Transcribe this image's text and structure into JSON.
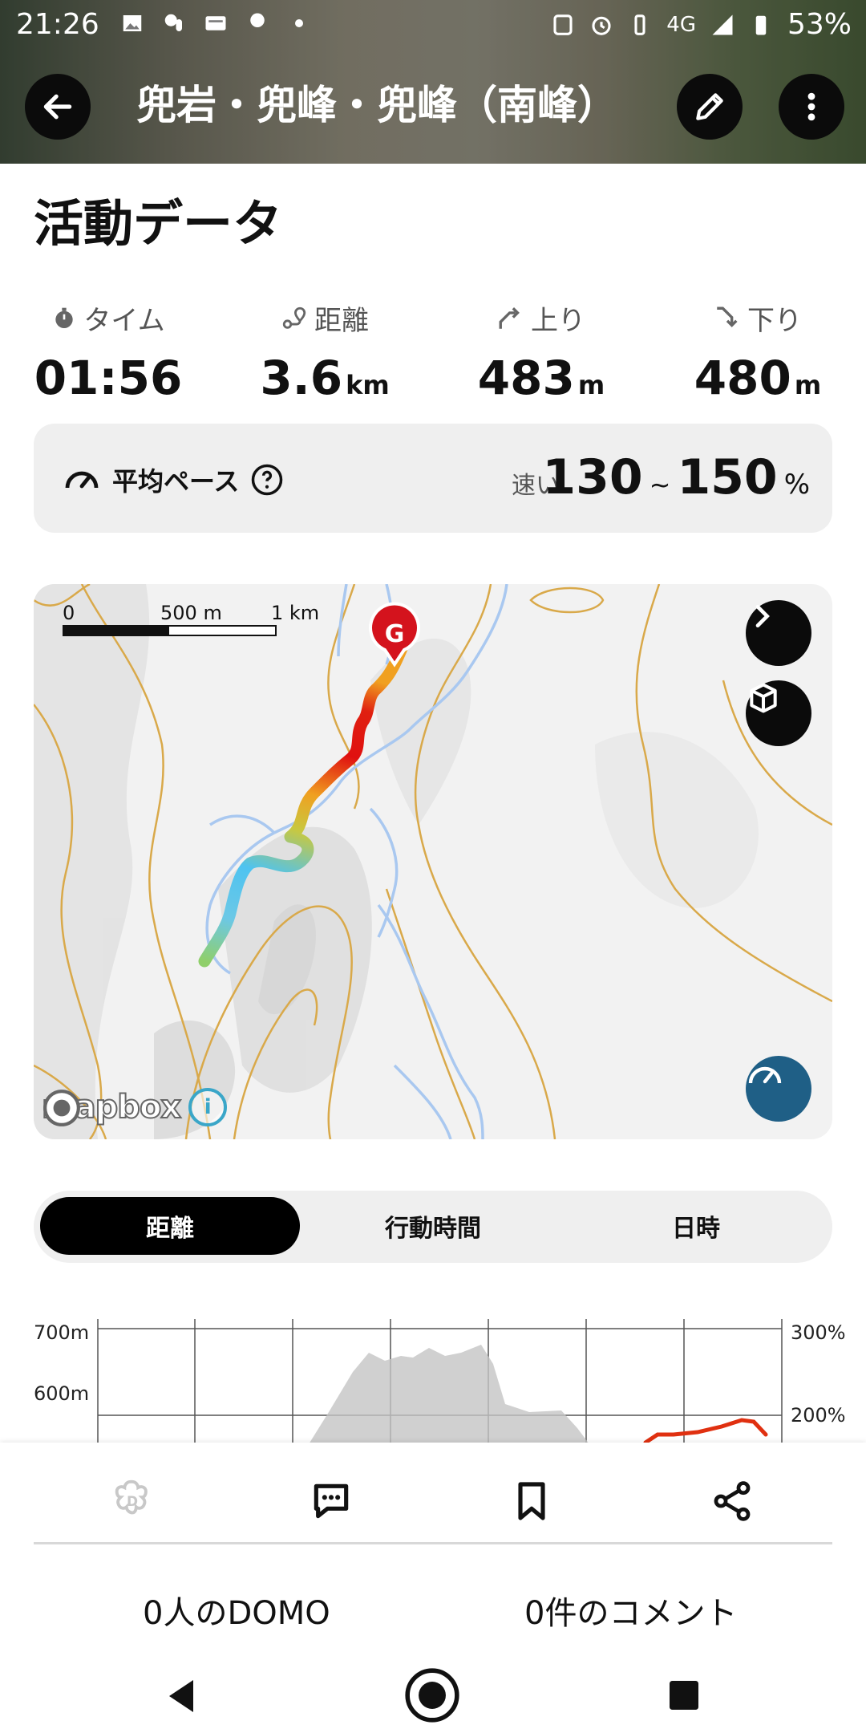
{
  "status_bar": {
    "time": "21:26",
    "network": "4G",
    "battery": "53%"
  },
  "header": {
    "title": "兜岩・兜峰・兜峰（南峰）",
    "back_icon": "arrow-left-icon",
    "edit_icon": "pencil-icon",
    "more_icon": "more-vertical-icon"
  },
  "activity": {
    "section_title": "活動データ",
    "stats": [
      {
        "label": "タイム",
        "value": "01:56",
        "unit": "",
        "icon": "stopwatch-icon"
      },
      {
        "label": "距離",
        "value": "3.6",
        "unit": "km",
        "icon": "route-icon"
      },
      {
        "label": "上り",
        "value": "483",
        "unit": "m",
        "icon": "ascent-icon"
      },
      {
        "label": "下り",
        "value": "480",
        "unit": "m",
        "icon": "descent-icon"
      }
    ],
    "pace": {
      "label": "平均ペース",
      "speed_word": "速い",
      "low": "130",
      "tilde": "~",
      "high": "150",
      "unit": "%"
    }
  },
  "map": {
    "scale": {
      "zero": "0",
      "mid": "500 m",
      "max": "1 km"
    },
    "goal_marker": "G",
    "attribution": "mapbox",
    "info_label": "i"
  },
  "tabs": [
    {
      "label": "距離",
      "active": true
    },
    {
      "label": "行動時間",
      "active": false
    },
    {
      "label": "日時",
      "active": false
    }
  ],
  "chart": {
    "y_left": [
      "700m",
      "600m"
    ],
    "y_right": [
      "300%",
      "200%"
    ]
  },
  "actions": {
    "domo_count": "0人のDOMO",
    "comment_count": "0件のコメント"
  },
  "colors": {
    "route_start": "#8fcf6a",
    "route_slow": "#4ec3f0",
    "route_mid": "#f0a020",
    "route_fast": "#e01010",
    "contour": "#d9a94a",
    "river": "#a9c8f0"
  }
}
